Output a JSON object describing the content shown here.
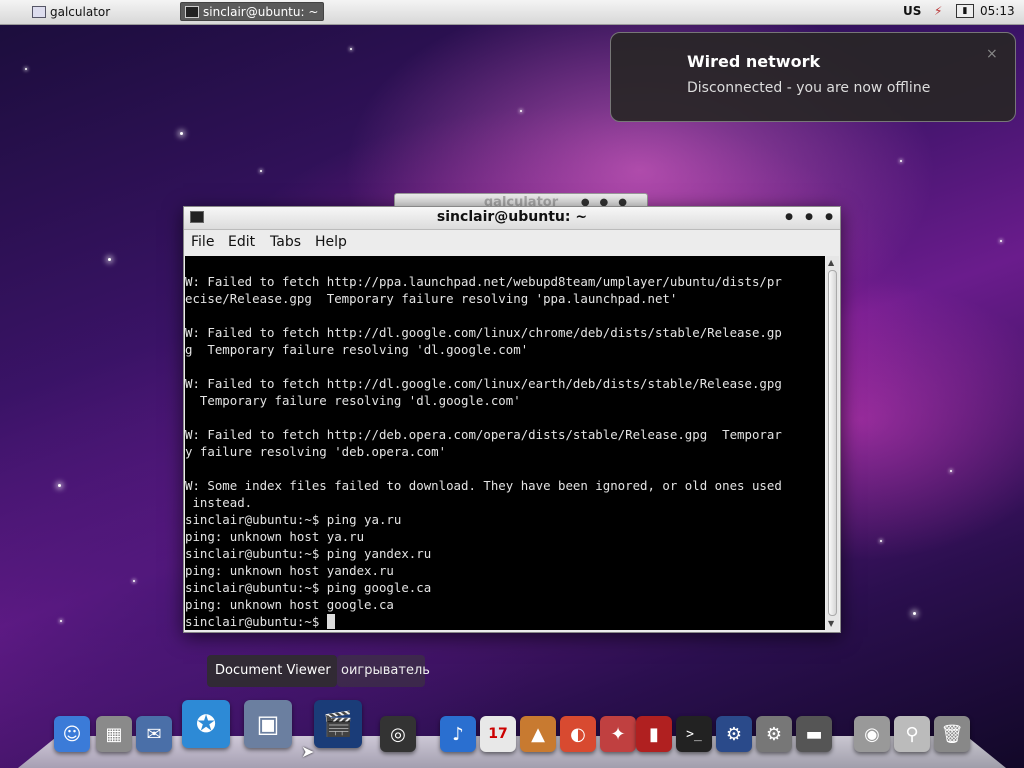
{
  "top_panel": {
    "tasks": [
      {
        "label": "galculator"
      },
      {
        "label": "sinclair@ubuntu: ~"
      }
    ],
    "keyboard_layout": "US",
    "clock": "05:13"
  },
  "notification": {
    "title": "Wired network",
    "message": "Disconnected - you are now offline",
    "close_glyph": "×"
  },
  "background_window": {
    "title": "galculator"
  },
  "terminal": {
    "title": "sinclair@ubuntu: ~",
    "menu": [
      "File",
      "Edit",
      "Tabs",
      "Help"
    ],
    "lines": [
      "W: Failed to fetch http://ppa.launchpad.net/webupd8team/umplayer/ubuntu/dists/pr",
      "ecise/Release.gpg  Temporary failure resolving 'ppa.launchpad.net'",
      "",
      "W: Failed to fetch http://dl.google.com/linux/chrome/deb/dists/stable/Release.gp",
      "g  Temporary failure resolving 'dl.google.com'",
      "",
      "W: Failed to fetch http://dl.google.com/linux/earth/deb/dists/stable/Release.gpg",
      "  Temporary failure resolving 'dl.google.com'",
      "",
      "W: Failed to fetch http://deb.opera.com/opera/dists/stable/Release.gpg  Temporar",
      "y failure resolving 'deb.opera.com'",
      "",
      "W: Some index files failed to download. They have been ignored, or old ones used",
      " instead.",
      "sinclair@ubuntu:~$ ping ya.ru",
      "ping: unknown host ya.ru",
      "sinclair@ubuntu:~$ ping yandex.ru",
      "ping: unknown host yandex.ru",
      "sinclair@ubuntu:~$ ping google.ca",
      "ping: unknown host google.ca",
      "sinclair@ubuntu:~$ "
    ]
  },
  "tooltips": {
    "active": "Document Viewer",
    "behind": "оигрыватель"
  },
  "dock": {
    "items": [
      {
        "icon": "finder-icon",
        "color": "#3b7bd8",
        "glyph": "☺"
      },
      {
        "icon": "calculator-icon",
        "color": "#8a8a8a",
        "glyph": "▦"
      },
      {
        "icon": "mail-icon",
        "color": "#4a6fa8",
        "glyph": "✉"
      },
      {
        "icon": "safari-icon",
        "color": "#2d8ad6",
        "glyph": "✪"
      },
      {
        "icon": "document-viewer-icon",
        "color": "#6b7fa0",
        "glyph": "▣"
      },
      {
        "icon": "video-editor-icon",
        "color": "#1a3c78",
        "glyph": "🎬"
      },
      {
        "icon": "headphones-icon",
        "color": "#333333",
        "glyph": "◎"
      },
      {
        "icon": "itunes-icon",
        "color": "#2a6fd0",
        "glyph": "♪"
      },
      {
        "icon": "calendar-icon",
        "color": "#e8e8e8",
        "glyph": "17"
      },
      {
        "icon": "photo-icon",
        "color": "#c87a30",
        "glyph": "▲"
      },
      {
        "icon": "office-icon",
        "color": "#d84a30",
        "glyph": "◐"
      },
      {
        "icon": "utility-icon",
        "color": "#c04040",
        "glyph": "✦"
      },
      {
        "icon": "media-player-icon",
        "color": "#b02020",
        "glyph": "▮"
      },
      {
        "icon": "terminal-icon",
        "color": "#222222",
        "glyph": ">_"
      },
      {
        "icon": "network-icon",
        "color": "#2a4a8a",
        "glyph": "⚙"
      },
      {
        "icon": "system-preferences-icon",
        "color": "#777777",
        "glyph": "⚙"
      },
      {
        "icon": "drive-icon",
        "color": "#555555",
        "glyph": "▬"
      },
      {
        "icon": "disk-utility-icon",
        "color": "#999999",
        "glyph": "◉"
      },
      {
        "icon": "search-icon",
        "color": "#bbbbbb",
        "glyph": "⚲"
      },
      {
        "icon": "trash-icon",
        "color": "#888888",
        "glyph": "🗑"
      }
    ]
  }
}
